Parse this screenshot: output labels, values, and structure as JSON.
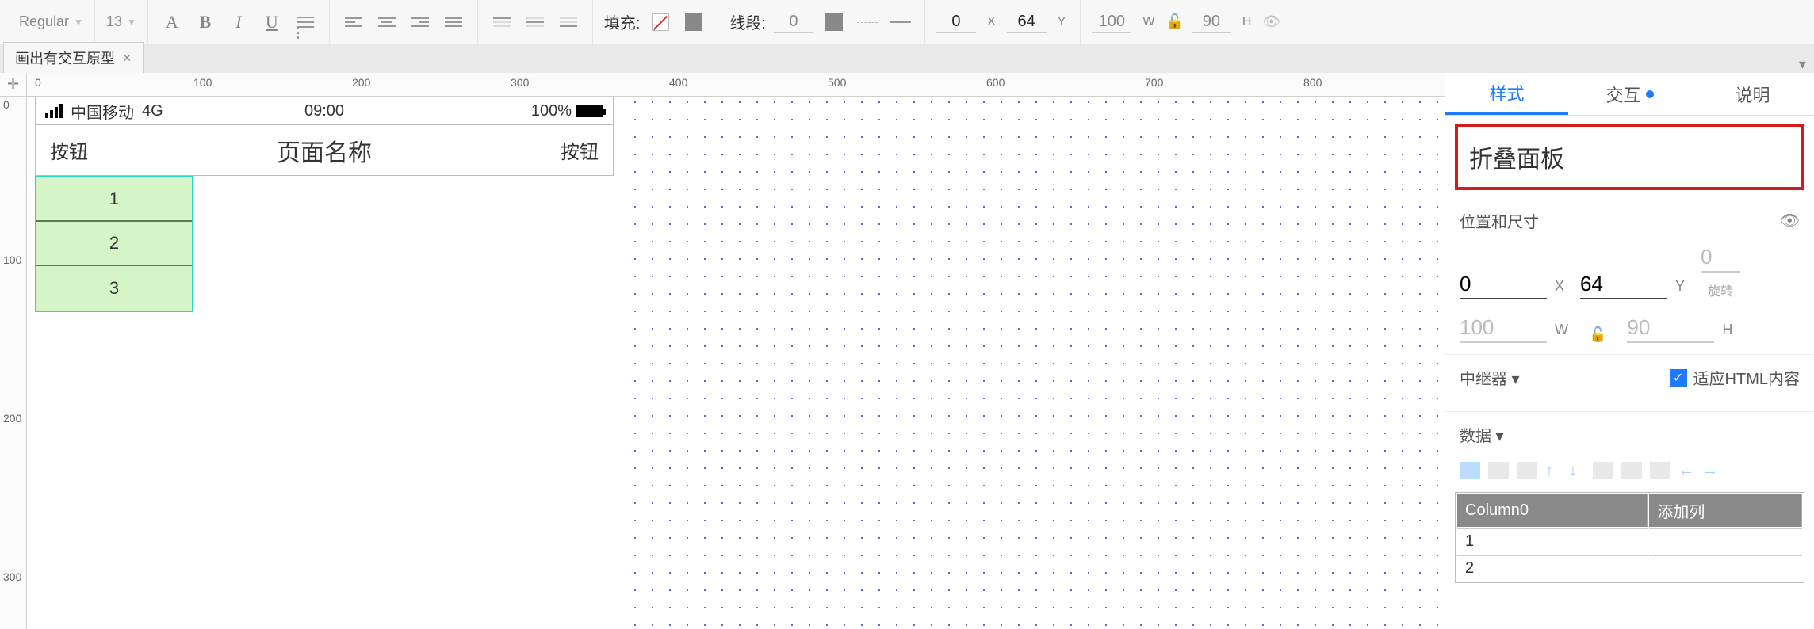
{
  "toolbar": {
    "font_family": "Regular",
    "font_size": "13",
    "fill_label": "填充:",
    "line_label": "线段:",
    "line_width": "0",
    "pos_x": "0",
    "pos_y": "64",
    "size_w": "100",
    "size_h": "90"
  },
  "tab": {
    "title": "画出有交互原型"
  },
  "ruler_h": [
    "0",
    "100",
    "200",
    "300",
    "400",
    "500",
    "600",
    "700",
    "800"
  ],
  "ruler_v": [
    "0",
    "100",
    "200",
    "300"
  ],
  "device": {
    "carrier": "中国移动",
    "network": "4G",
    "time": "09:00",
    "battery_pct": "100%",
    "left_btn": "按钮",
    "title": "页面名称",
    "right_btn": "按钮"
  },
  "accordion_rows": [
    "1",
    "2",
    "3"
  ],
  "inspector": {
    "tab_style": "样式",
    "tab_interact": "交互",
    "tab_notes": "说明",
    "selection_name": "折叠面板",
    "section_pos": "位置和尺寸",
    "x": "0",
    "y": "64",
    "w": "100",
    "h": "90",
    "rotate": "0",
    "rotate_label": "旋转",
    "repeater_label": "中继器",
    "fit_html": "适应HTML内容",
    "data_label": "数据",
    "col0": "Column0",
    "add_col": "添加列",
    "rows": [
      "1",
      "2"
    ]
  },
  "labels": {
    "x": "X",
    "y": "Y",
    "w": "W",
    "h": "H",
    "deg": "°"
  }
}
